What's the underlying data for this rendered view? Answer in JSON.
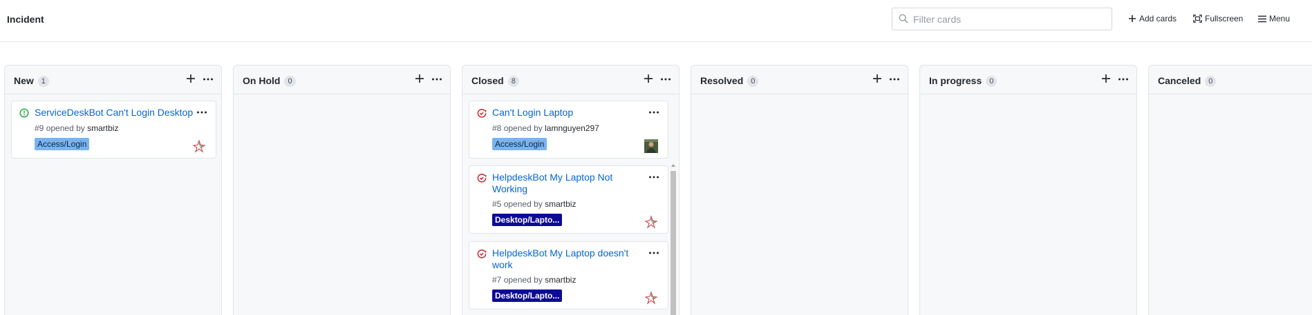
{
  "header": {
    "title": "Incident",
    "filter_placeholder": "Filter cards",
    "add_cards_label": "Add cards",
    "fullscreen_label": "Fullscreen",
    "menu_label": "Menu"
  },
  "columns": [
    {
      "name": "New",
      "count": "1",
      "cards": [
        {
          "title": "ServiceDeskBot Can't Login Desktop",
          "number": "#9",
          "opened_by": "opened by",
          "author": "smartbiz",
          "label": "Access/Login",
          "state": "open-issue"
        }
      ]
    },
    {
      "name": "On Hold",
      "count": "0",
      "cards": []
    },
    {
      "name": "Closed",
      "count": "8",
      "cards": [
        {
          "title": "Can't Login Laptop",
          "number": "#8",
          "opened_by": "opened by",
          "author": "lamnguyen297",
          "label": "Access/Login",
          "state": "closed-issue"
        },
        {
          "title": "HelpdeskBot My Laptop Not Working",
          "number": "#5",
          "opened_by": "opened by",
          "author": "smartbiz",
          "label": "Desktop/Lapto...",
          "state": "closed-issue"
        },
        {
          "title": "HelpdeskBot My Laptop doesn't work",
          "number": "#7",
          "opened_by": "opened by",
          "author": "smartbiz",
          "label": "Desktop/Lapto...",
          "state": "closed-issue"
        }
      ]
    },
    {
      "name": "Resolved",
      "count": "0",
      "cards": []
    },
    {
      "name": "In progress",
      "count": "0",
      "cards": []
    },
    {
      "name": "Canceled",
      "count": "0",
      "cards": []
    }
  ],
  "colors": {
    "link": "#0366d6",
    "open_state": "#28a745",
    "closed_state": "#cb2431",
    "label_access": "#7bb3ef",
    "label_desktop": "#0d0b96"
  }
}
